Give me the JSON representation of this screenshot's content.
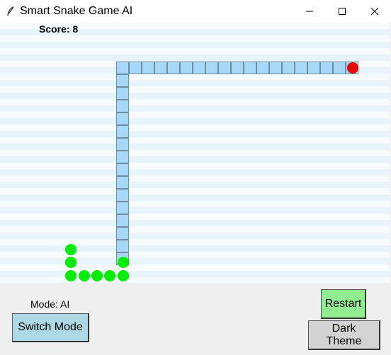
{
  "window": {
    "title": "Smart Snake Game AI",
    "icon": "feather-icon",
    "controls": [
      "minimize-icon",
      "maximize-icon",
      "close-icon"
    ]
  },
  "game": {
    "score_text": "Score: 8",
    "score": 8,
    "colors": {
      "snake_body": "#a8d8f8",
      "snake_border": "#6a8ea8",
      "food": "#ee0000",
      "obstacle": "#00ee00",
      "stripe_light": "#f5fbff",
      "stripe_dark": "#e7f4fc"
    }
  },
  "controls": {
    "mode_label": "Mode: AI",
    "switch_mode": "Switch Mode",
    "restart": "Restart",
    "dark_theme": "Dark Theme"
  }
}
